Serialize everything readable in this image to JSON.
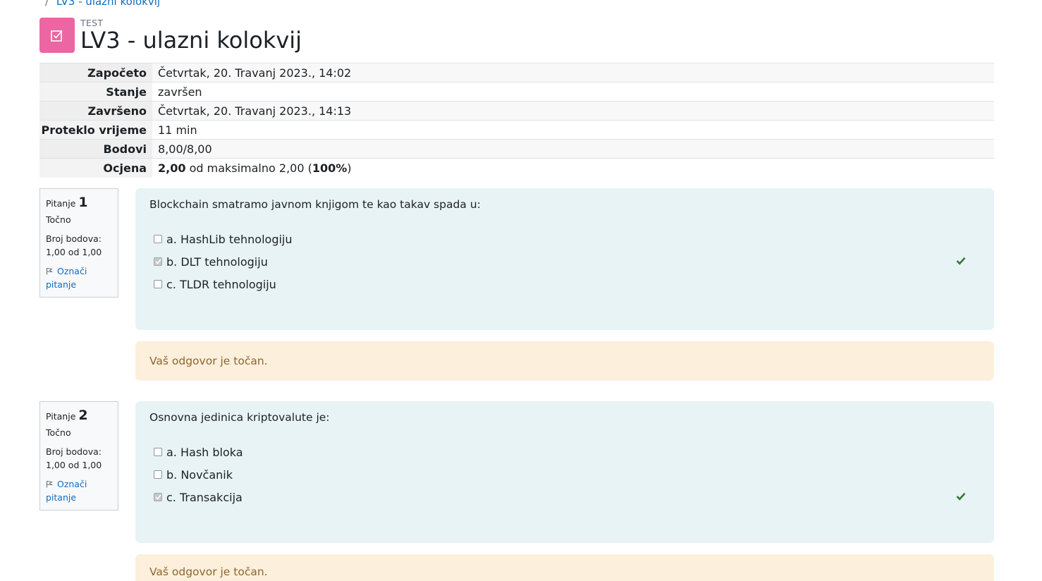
{
  "breadcrumb": {
    "separator": "/",
    "current": "LV3 - ulazni kolokvij"
  },
  "header": {
    "label": "TEST",
    "title": "LV3 - ulazni kolokvij",
    "icon": "quiz-checkbox-icon",
    "icon_color": "#eb66a2"
  },
  "summary": [
    {
      "label": "Započeto",
      "value": "Četvrtak, 20. Travanj 2023., 14:02"
    },
    {
      "label": "Stanje",
      "value": "završen"
    },
    {
      "label": "Završeno",
      "value": "Četvrtak, 20. Travanj 2023., 14:13"
    },
    {
      "label": "Proteklo vrijeme",
      "value": "11 min"
    },
    {
      "label": "Bodovi",
      "value": "8,00/8,00"
    },
    {
      "label": "Ocjena",
      "grade": "2,00",
      "middle": " od maksimalno 2,00 (",
      "percent": "100%",
      "end": ")"
    }
  ],
  "questions": [
    {
      "prefix": "Pitanje",
      "number": "1",
      "state": "Točno",
      "grade_label": "Broj bodova:",
      "grade_value": "1,00 od 1,00",
      "flag_label": "Označi pitanje",
      "text": "Blockchain smatramo javnom knjigom te kao takav spada u:",
      "answers": [
        {
          "label": "a. HashLib tehnologiju",
          "checked": false,
          "correct": false
        },
        {
          "label": "b. DLT tehnologiju",
          "checked": true,
          "correct": true
        },
        {
          "label": "c. TLDR tehnologiju",
          "checked": false,
          "correct": false
        }
      ],
      "feedback": "Vaš odgovor je točan."
    },
    {
      "prefix": "Pitanje",
      "number": "2",
      "state": "Točno",
      "grade_label": "Broj bodova:",
      "grade_value": "1,00 od 1,00",
      "flag_label": "Označi pitanje",
      "text": "Osnovna jedinica kriptovalute je:",
      "answers": [
        {
          "label": "a. Hash bloka",
          "checked": false,
          "correct": false
        },
        {
          "label": "b. Novčanik",
          "checked": false,
          "correct": false
        },
        {
          "label": "c. Transakcija",
          "checked": true,
          "correct": true
        }
      ],
      "feedback": "Vaš odgovor je točan."
    }
  ],
  "colors": {
    "correct_tick": "#357a32",
    "formulation_bg": "#e7f3f5",
    "feedback_bg": "#fcefdc",
    "feedback_text": "#8e662e",
    "link": "#0f6cbf"
  }
}
